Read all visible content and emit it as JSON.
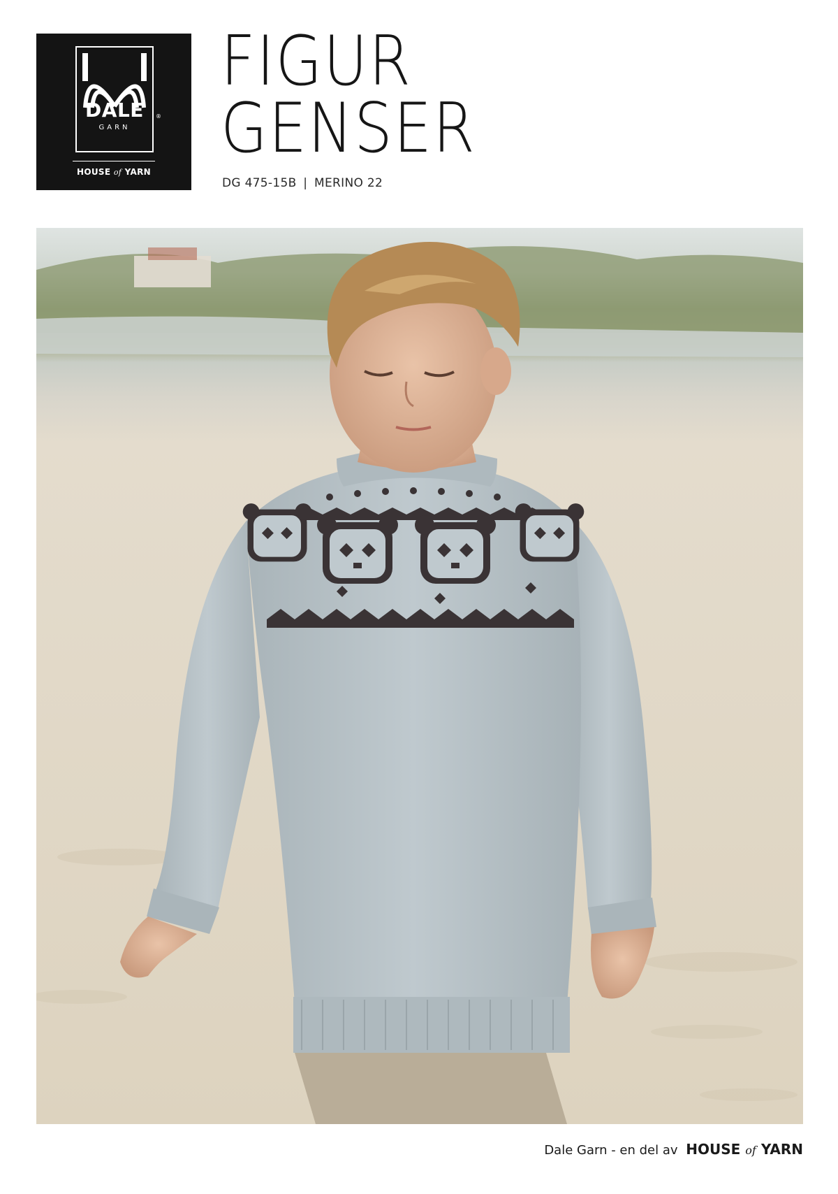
{
  "logo": {
    "brand": "DALE",
    "registered": "®",
    "sub": "GARN",
    "house_left": "HOUSE",
    "house_of": "of",
    "house_right": "YARN"
  },
  "title": {
    "line1": "FIGUR",
    "line2": "GENSER"
  },
  "subtitle": {
    "code": "DG 475-15B",
    "separator": "|",
    "yarn": "MERINO 22"
  },
  "photo": {
    "subject": "boy-in-panda-yoke-sweater",
    "colors": {
      "sweater": "#b9c4c9",
      "pattern": "#3a3335",
      "sand": "#e3dac8"
    }
  },
  "footer": {
    "text": "Dale Garn - en del av",
    "brand_left": "HOUSE",
    "brand_of": "of",
    "brand_right": "YARN"
  }
}
